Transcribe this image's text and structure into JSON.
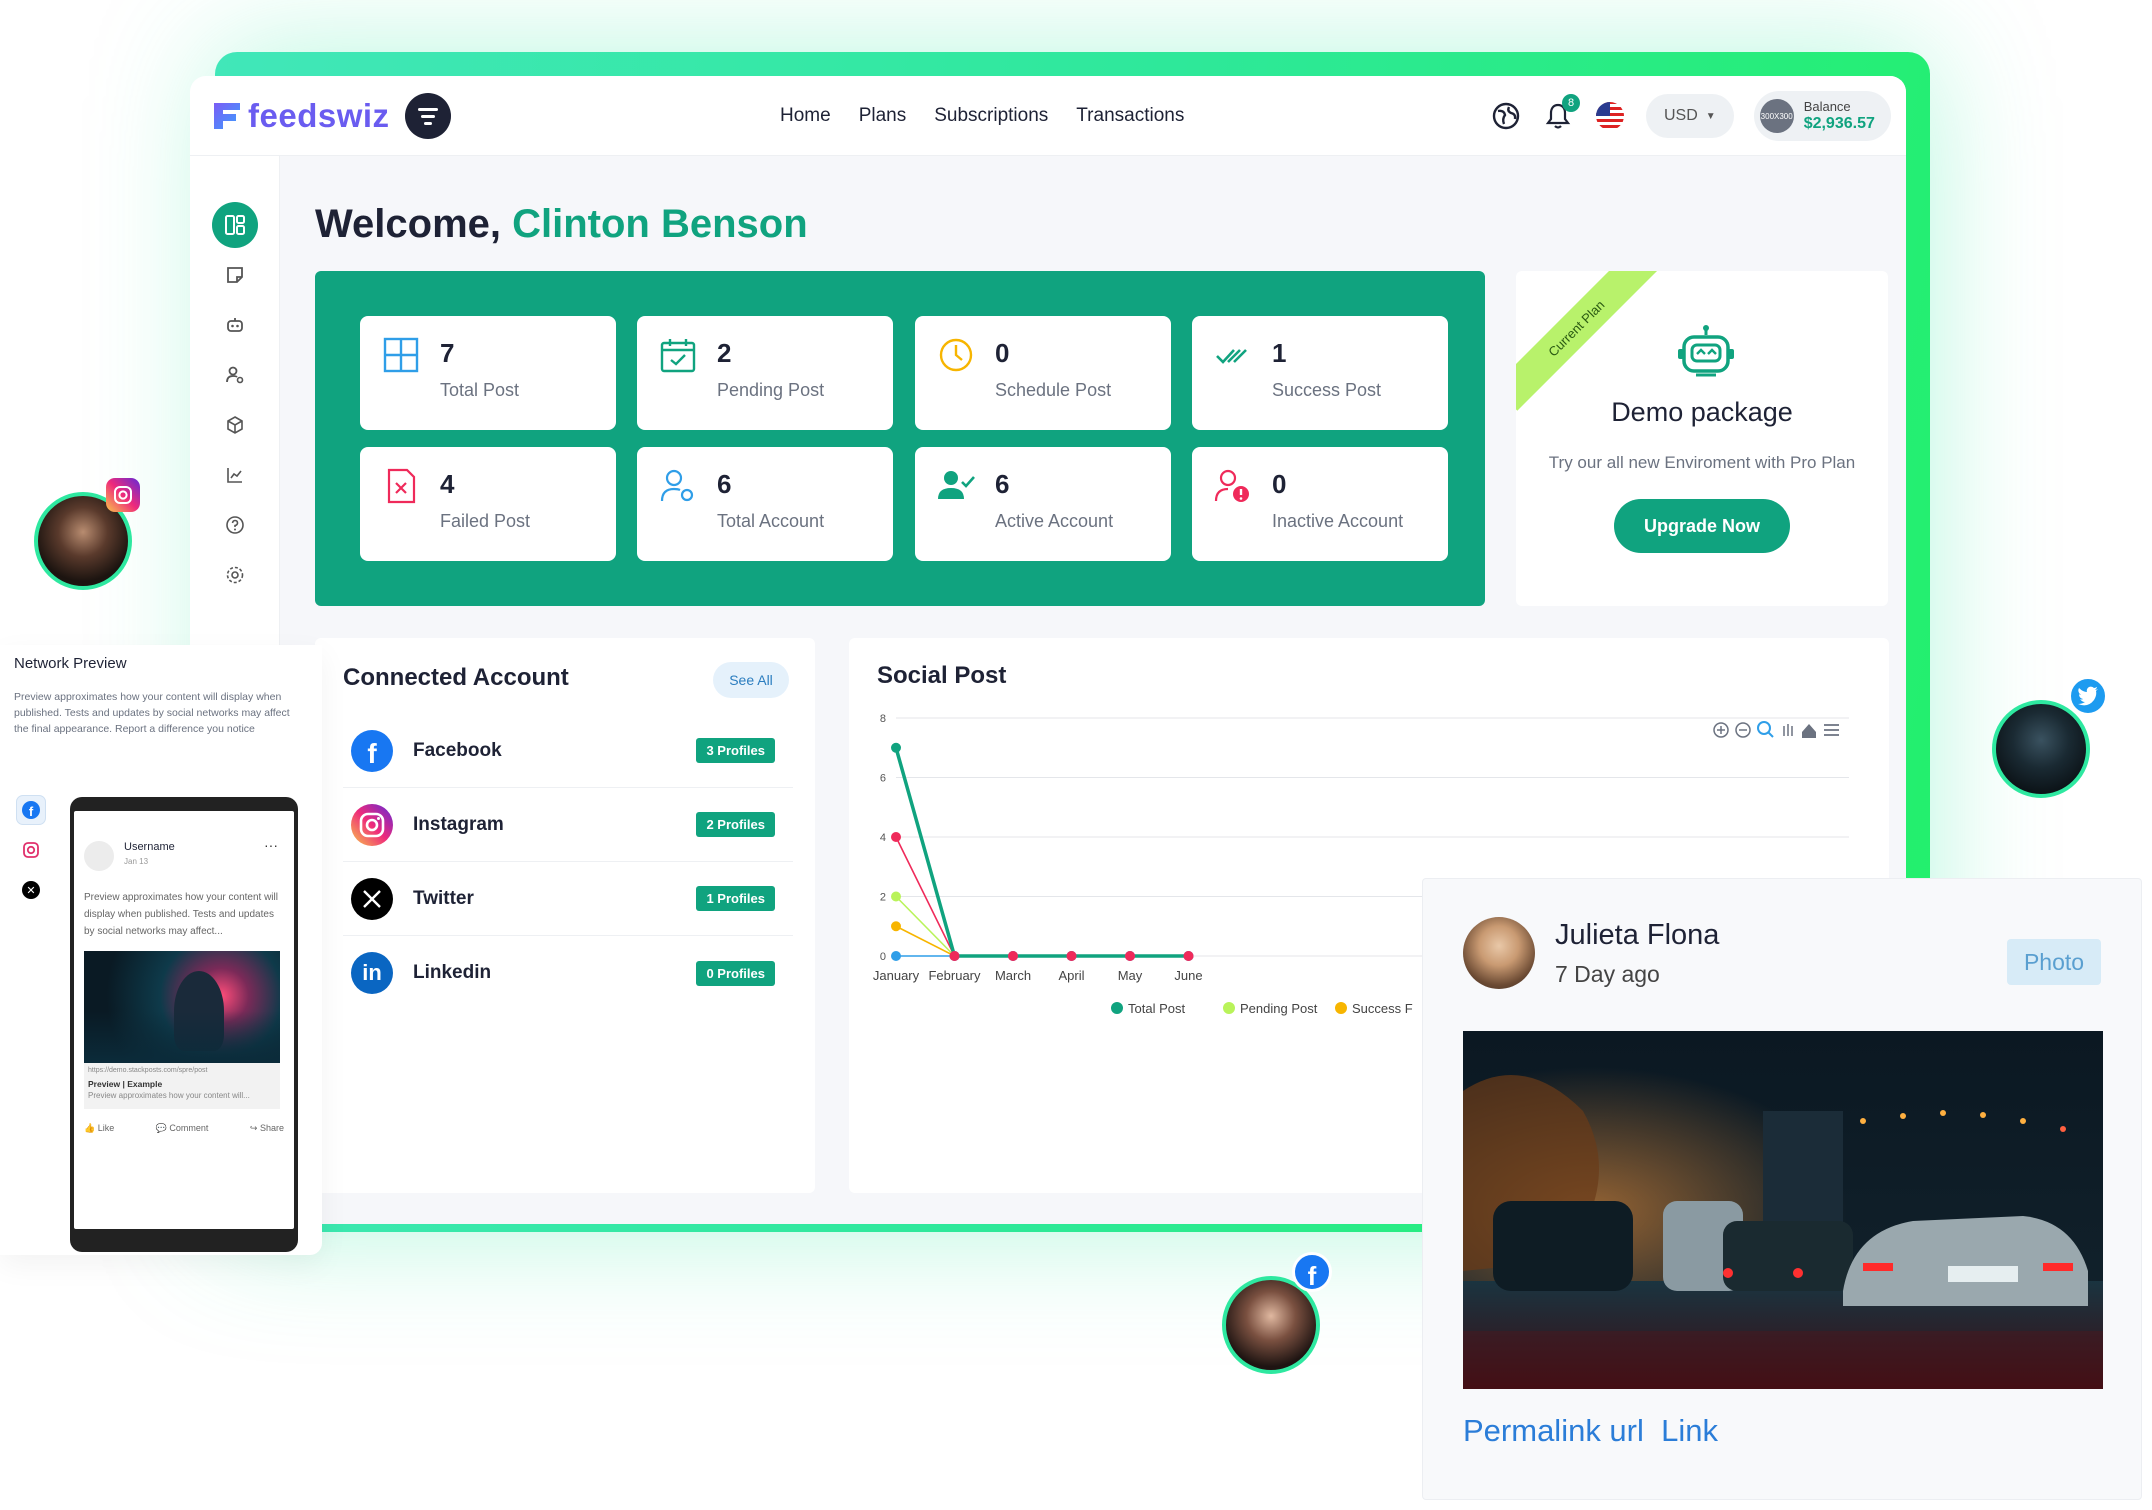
{
  "brand": {
    "name": "feedswiz"
  },
  "nav": {
    "items": [
      "Home",
      "Plans",
      "Subscriptions",
      "Transactions"
    ]
  },
  "header": {
    "notif_count": "8",
    "currency": "USD",
    "balance_label": "Balance",
    "balance_value": "$2,936.57",
    "avatar_text": "300X300"
  },
  "sidebar": {
    "icons": [
      "dashboard-icon",
      "sticky-note-icon",
      "robot-icon",
      "users-settings-icon",
      "cube-icon",
      "chart-line-icon",
      "help-circle-icon",
      "settings-gear-icon"
    ]
  },
  "welcome": {
    "prefix": "Welcome,",
    "name": "Clinton Benson"
  },
  "stats": [
    {
      "value": "7",
      "label": "Total Post",
      "icon": "grid-icon"
    },
    {
      "value": "2",
      "label": "Pending Post",
      "icon": "calendar-check-icon"
    },
    {
      "value": "0",
      "label": "Schedule Post",
      "icon": "clock-icon"
    },
    {
      "value": "1",
      "label": "Success Post",
      "icon": "double-check-icon"
    },
    {
      "value": "4",
      "label": "Failed Post",
      "icon": "file-x-icon"
    },
    {
      "value": "6",
      "label": "Total Account",
      "icon": "user-gear-icon"
    },
    {
      "value": "6",
      "label": "Active Account",
      "icon": "user-check-icon"
    },
    {
      "value": "0",
      "label": "Inactive Account",
      "icon": "user-alert-icon"
    }
  ],
  "plan": {
    "ribbon": "Current Plan",
    "name": "Demo package",
    "description": "Try our all new Enviroment with Pro Plan",
    "button": "Upgrade Now"
  },
  "connected": {
    "title": "Connected Account",
    "see_all": "See All",
    "accounts": [
      {
        "name": "Facebook",
        "profiles": "3 Profiles",
        "icon": "facebook-icon"
      },
      {
        "name": "Instagram",
        "profiles": "2 Profiles",
        "icon": "instagram-icon"
      },
      {
        "name": "Twitter",
        "profiles": "1 Profiles",
        "icon": "x-twitter-icon"
      },
      {
        "name": "Linkedin",
        "profiles": "0 Profiles",
        "icon": "linkedin-icon"
      }
    ]
  },
  "social": {
    "title": "Social Post"
  },
  "chart_data": {
    "type": "line",
    "title": "Social Post",
    "categories": [
      "January",
      "February",
      "March",
      "April",
      "May",
      "June"
    ],
    "ylim": [
      0,
      8
    ],
    "yticks": [
      0,
      2,
      4,
      6,
      8
    ],
    "series": [
      {
        "name": "Total Post",
        "color": "#10a37f",
        "values": [
          7,
          0,
          0,
          0,
          0,
          0
        ]
      },
      {
        "name": "Pending Post",
        "color": "#b9f35a",
        "values": [
          2,
          0,
          0,
          0,
          0,
          0
        ]
      },
      {
        "name": "Success F",
        "color": "#f7b500",
        "values": [
          1,
          0,
          0,
          0,
          0,
          0
        ]
      },
      {
        "name": "",
        "color": "#ef2a5a",
        "values": [
          4,
          0,
          0,
          0,
          0,
          0
        ]
      },
      {
        "name": "",
        "color": "#2f9ee8",
        "values": [
          0,
          0,
          0,
          0,
          0,
          0
        ]
      }
    ],
    "legend_position": "bottom",
    "grid": true
  },
  "network_preview": {
    "title": "Network Preview",
    "description": "Preview approximates how your content will display when published. Tests and updates by social networks may affect the final appearance. Report a difference you notice",
    "post": {
      "username": "Username",
      "date": "Jan 13",
      "text": "Preview approximates how your content will display when published. Tests and updates by social networks may affect...",
      "link_url": "https://demo.stackposts.com/spre/post",
      "link_title": "Preview | Example",
      "link_desc": "Preview approximates how your content will...",
      "actions": [
        "Like",
        "Comment",
        "Share"
      ]
    }
  },
  "post_card": {
    "name": "Julieta Flona",
    "time": "7 Day ago",
    "type": "Photo",
    "link": "Permalink url  Link"
  }
}
